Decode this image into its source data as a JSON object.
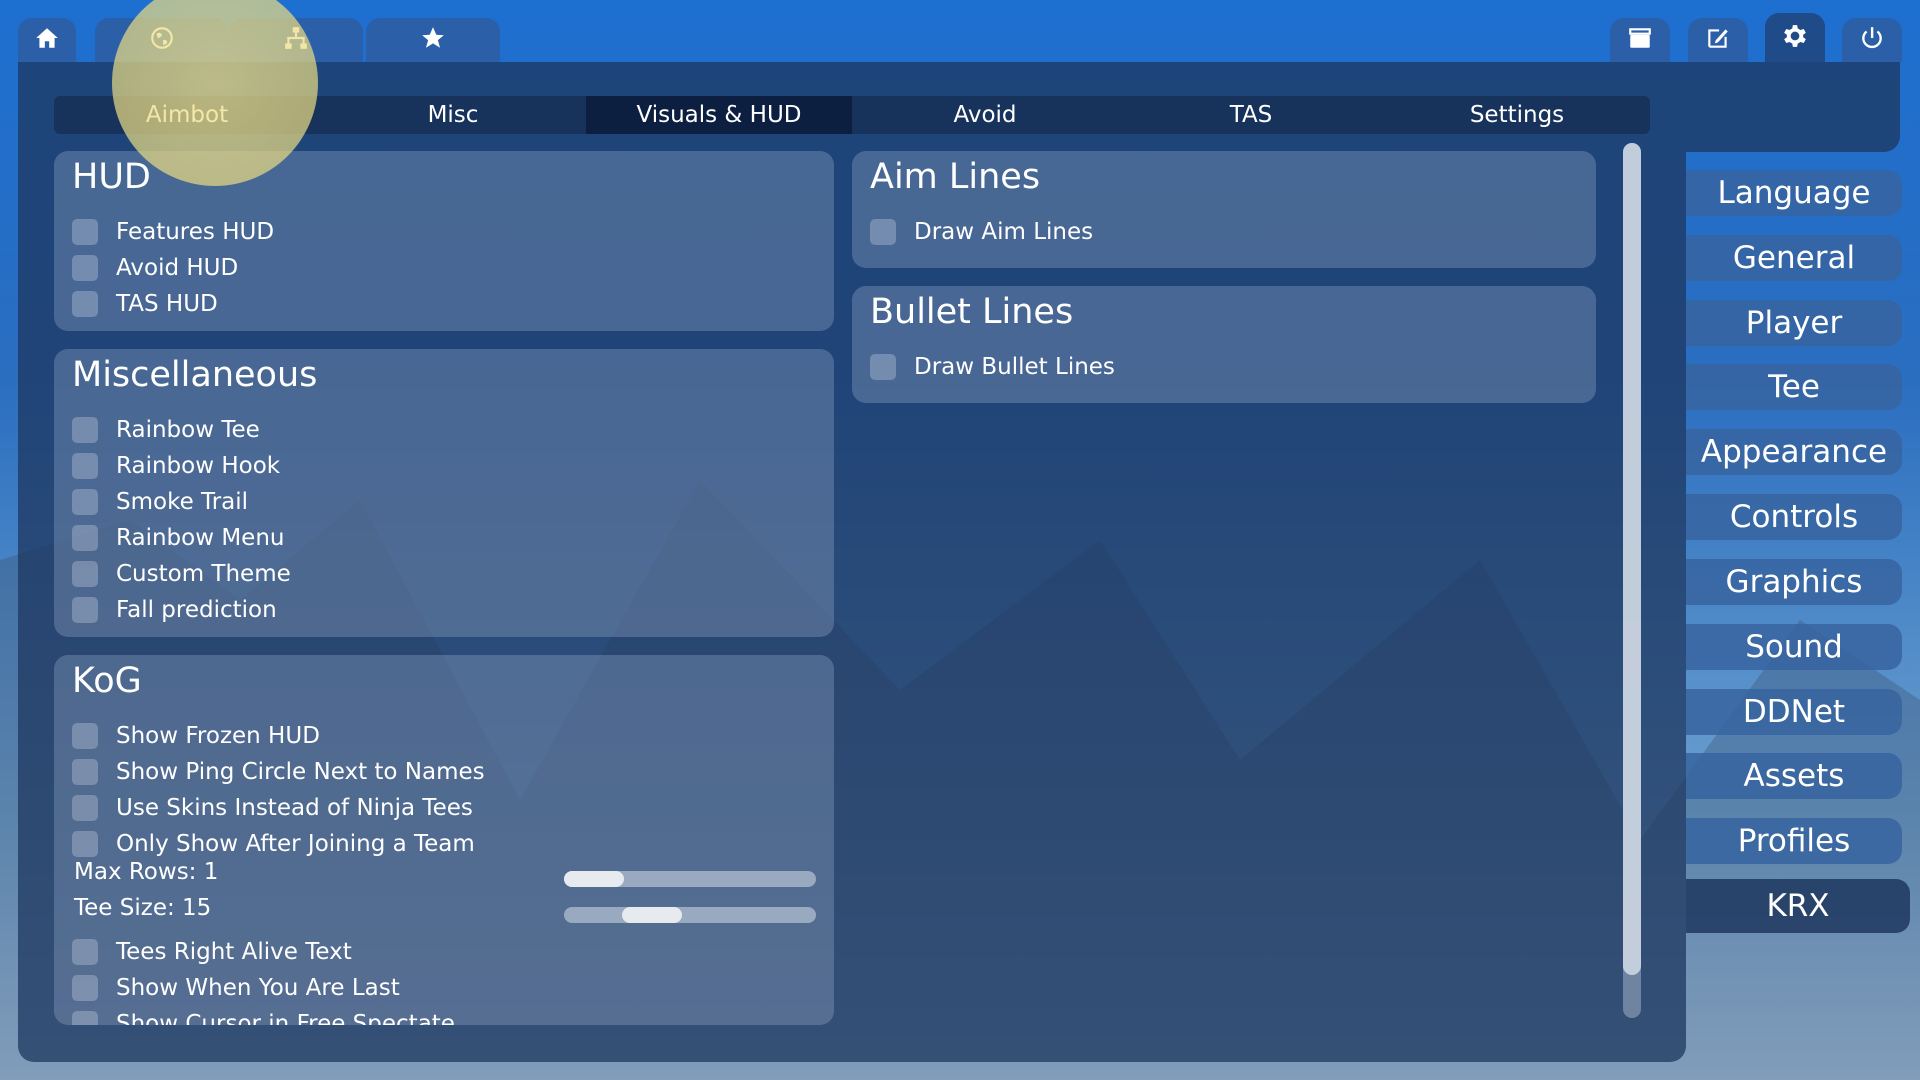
{
  "top_tabs_left": [
    {
      "name": "home",
      "icon": "home-icon"
    },
    {
      "name": "internet",
      "icon": "globe-icon"
    },
    {
      "name": "lan",
      "icon": "network-icon"
    },
    {
      "name": "favorites",
      "icon": "star-icon"
    }
  ],
  "top_tabs_right": [
    {
      "name": "demos",
      "icon": "clapperboard-icon"
    },
    {
      "name": "editor",
      "icon": "edit-icon"
    },
    {
      "name": "settings",
      "icon": "gear-icon"
    },
    {
      "name": "quit",
      "icon": "power-icon"
    }
  ],
  "subtabs": [
    "Aimbot",
    "Misc",
    "Visuals & HUD",
    "Avoid",
    "TAS",
    "Settings"
  ],
  "active_subtab": "Visuals & HUD",
  "hud": {
    "title": "HUD",
    "items": [
      "Features HUD",
      "Avoid HUD",
      "TAS HUD"
    ]
  },
  "misc": {
    "title": "Miscellaneous",
    "items": [
      "Rainbow Tee",
      "Rainbow Hook",
      "Smoke Trail",
      "Rainbow Menu",
      "Custom Theme",
      "Fall prediction"
    ]
  },
  "kog": {
    "title": "KoG",
    "items_top": [
      "Show Frozen HUD",
      "Show Ping Circle Next to Names",
      "Use Skins Instead of Ninja Tees",
      "Only Show After Joining a Team"
    ],
    "max_rows_label": "Max Rows: 1",
    "max_rows_level": 0.0,
    "tee_size_label": "Tee Size: 15",
    "tee_size_level": 0.3,
    "items_bottom": [
      "Tees Right Alive Text",
      "Show When You Are Last",
      "Show Cursor in Free Spectate"
    ]
  },
  "aim_lines": {
    "title": "Aim Lines",
    "items": [
      "Draw Aim Lines"
    ]
  },
  "bullet_lines": {
    "title": "Bullet Lines",
    "items": [
      "Draw Bullet Lines"
    ]
  },
  "side_menu": [
    "Language",
    "General",
    "Player",
    "Tee",
    "Appearance",
    "Controls",
    "Graphics",
    "Sound",
    "DDNet",
    "Assets",
    "Profiles",
    "KRX"
  ],
  "active_side": "KRX",
  "colors": {
    "accent": "#2b5fa8",
    "panel": "#1e375f"
  }
}
